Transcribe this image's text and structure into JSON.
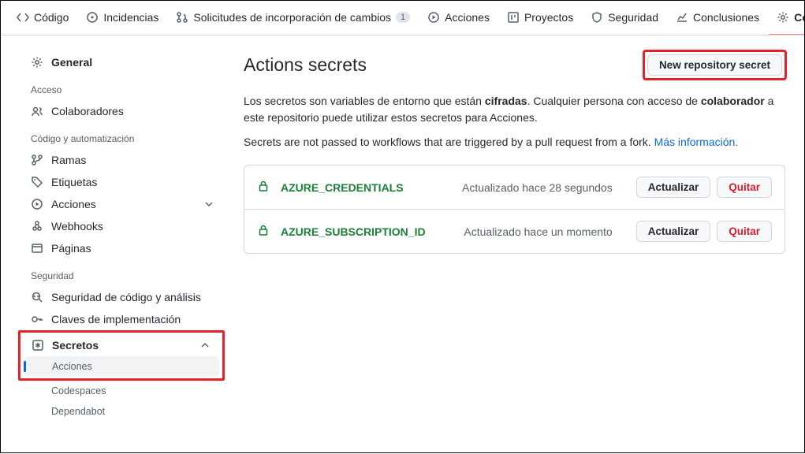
{
  "topnav": {
    "code": "Código",
    "issues": "Incidencias",
    "pulls": "Solicitudes de incorporación de cambios",
    "pulls_count": "1",
    "actions": "Acciones",
    "projects": "Proyectos",
    "security": "Seguridad",
    "insights": "Conclusiones",
    "settings": "Configuración"
  },
  "sidebar": {
    "general": "General",
    "access_heading": "Acceso",
    "collaborators": "Colaboradores",
    "code_heading": "Código y automatización",
    "branches": "Ramas",
    "tags": "Etiquetas",
    "actions": "Acciones",
    "webhooks": "Webhooks",
    "pages": "Páginas",
    "security_heading": "Seguridad",
    "code_security": "Seguridad de código y análisis",
    "deploy_keys": "Claves de implementación",
    "secrets": "Secretos",
    "secrets_sub": {
      "actions": "Acciones",
      "codespaces": "Codespaces",
      "dependabot": "Dependabot"
    }
  },
  "page": {
    "title": "Actions secrets",
    "new_button": "New repository secret",
    "desc1a": "Los secretos son variables de entorno que están ",
    "desc1b": "cifradas",
    "desc1c": ". Cualquier persona con acceso de ",
    "desc1d": "colaborador",
    "desc1e": " a este repositorio puede utilizar estos secretos para Acciones.",
    "desc2a": "Secrets are not passed to workflows that are triggered by a pull request from a fork. ",
    "desc2_link": "Más información.",
    "update_btn": "Actualizar",
    "remove_btn": "Quitar"
  },
  "secrets": [
    {
      "name": "AZURE_CREDENTIALS",
      "updated": "Actualizado hace 28 segundos"
    },
    {
      "name": "AZURE_SUBSCRIPTION_ID",
      "updated": "Actualizado hace un momento"
    }
  ]
}
